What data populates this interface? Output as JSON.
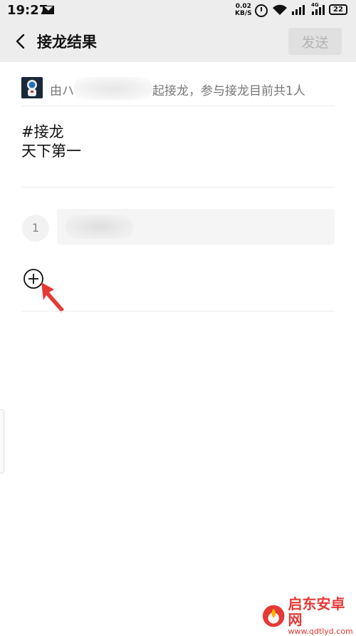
{
  "status_bar": {
    "time": "19:27",
    "net_speed_value": "0.02",
    "net_speed_unit": "KB/S",
    "network_type": "4G",
    "battery": "22"
  },
  "nav": {
    "title": "接龙结果",
    "send_label": "发送"
  },
  "initiator": {
    "prefix": "由",
    "name_partial": "ハ",
    "suffix": "起接龙，参与接龙目前共1人"
  },
  "content": {
    "title": "#接龙",
    "body": "天下第一"
  },
  "entries": [
    {
      "number": "1",
      "value": ""
    }
  ],
  "colors": {
    "nav_bg": "#ededed",
    "send_disabled_bg": "#e0e0e0",
    "send_disabled_text": "#b3b3b3",
    "annotation_arrow": "#e53935"
  },
  "watermark": {
    "name": "启东安卓网",
    "url": "www.qdtlyd.com"
  }
}
